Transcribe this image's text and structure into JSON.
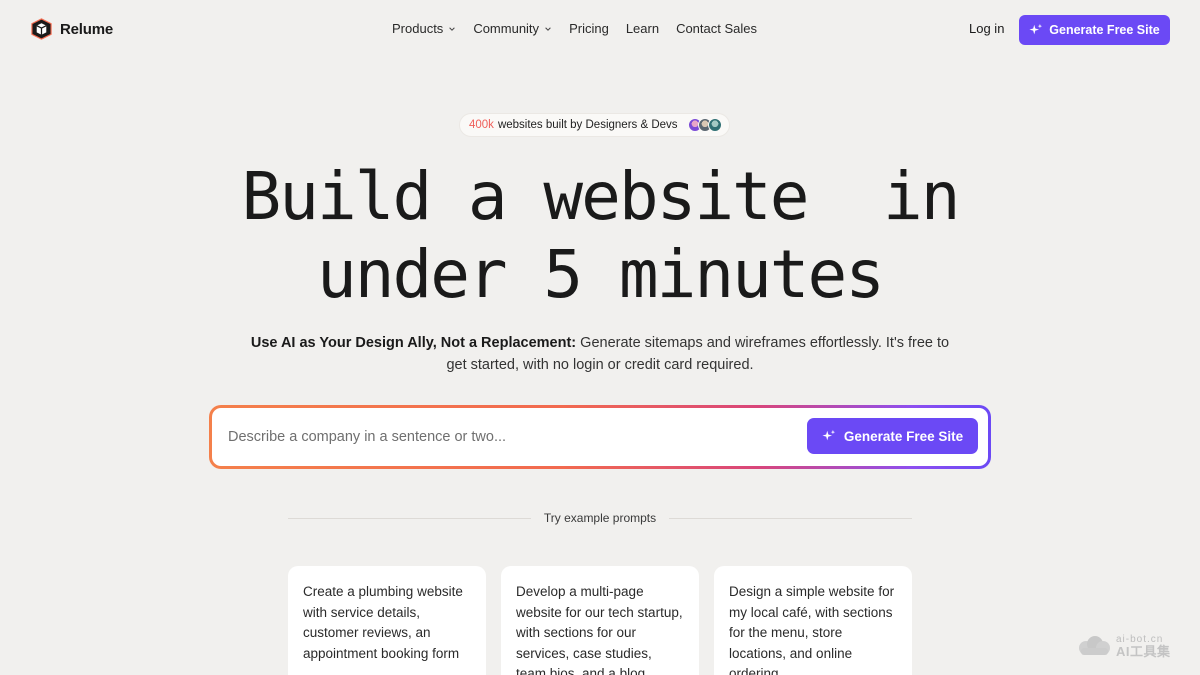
{
  "nav": {
    "brand": "Relume",
    "links": [
      {
        "label": "Products",
        "dropdown": true
      },
      {
        "label": "Community",
        "dropdown": true
      },
      {
        "label": "Pricing",
        "dropdown": false
      },
      {
        "label": "Learn",
        "dropdown": false
      },
      {
        "label": "Contact Sales",
        "dropdown": false
      }
    ],
    "login": "Log in",
    "cta": "Generate Free Site"
  },
  "badge": {
    "count": "400k",
    "text": "websites built by Designers & Devs"
  },
  "hero": {
    "title_line1": "Build a website  in",
    "title_line2": "under 5 minutes",
    "subtitle_bold": "Use AI as Your Design Ally, Not a Replacement:",
    "subtitle_rest": " Generate sitemaps and wireframes effortlessly. It's free to get started, with no login or credit card required."
  },
  "prompt": {
    "placeholder": "Describe a company in a sentence or two...",
    "value": "",
    "button": "Generate Free Site"
  },
  "examples": {
    "heading": "Try example prompts",
    "cards": [
      {
        "text": "Create a plumbing website with service details, customer reviews, an appointment booking form"
      },
      {
        "text": "Develop a multi-page website for our tech startup, with sections for our services, case studies, team bios, and a blog"
      },
      {
        "text": "Design a simple website for my local café,  with sections for the menu, store locations, and online ordering"
      }
    ]
  },
  "watermark": {
    "line1": "ai-bot.cn",
    "line2": "AI工具集"
  },
  "colors": {
    "accent": "#6b49f5",
    "background": "#f1f0ee",
    "badge_count": "#ef5f5a",
    "gradient": [
      "#f4804b",
      "#f26a4f",
      "#d9467a",
      "#8d4ff0",
      "#6b49f5"
    ]
  },
  "icons": {
    "logo": "relume-cube-logo",
    "cta": "sparkle-icon",
    "dropdown": "chevron-down-icon"
  }
}
